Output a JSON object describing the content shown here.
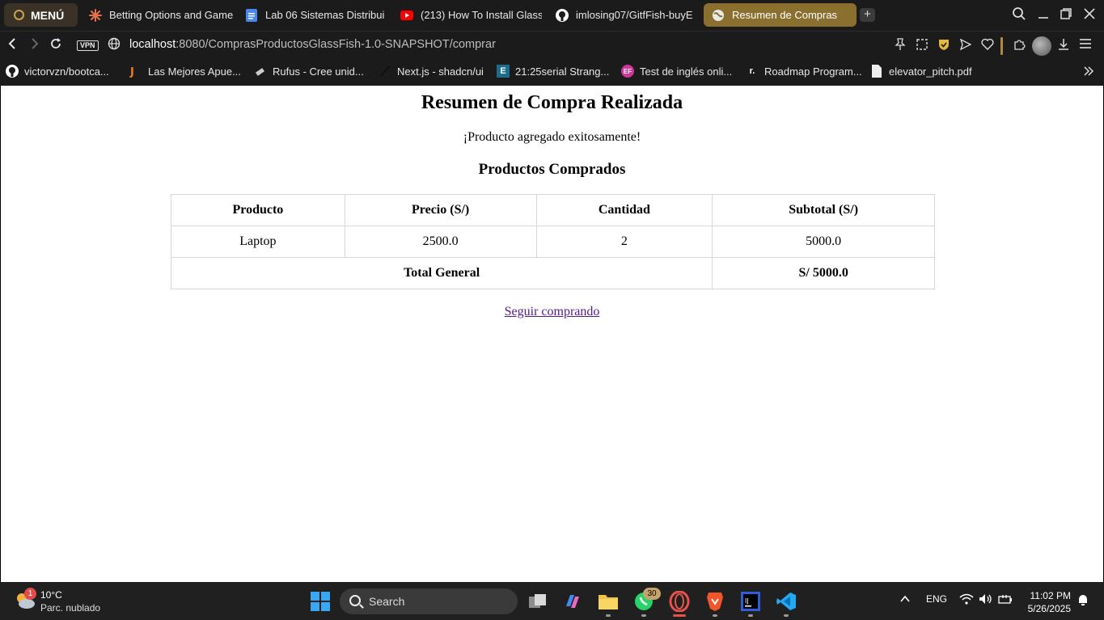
{
  "browser": {
    "menu_label": "MENÚ",
    "tabs": [
      {
        "label": "Betting Options and Game",
        "icon": "burst-icon"
      },
      {
        "label": "Lab 06 Sistemas Distribui",
        "icon": "docs-icon"
      },
      {
        "label": "(213) How To Install Glass",
        "icon": "youtube-icon"
      },
      {
        "label": "imlosing07/GitfFish-buyE",
        "icon": "github-icon"
      },
      {
        "label": "Resumen de Compras",
        "icon": "globe-icon",
        "active": true
      }
    ],
    "vpn_label": "VPN",
    "url_host": "localhost",
    "url_path": ":8080/ComprasProductosGlassFish-1.0-SNAPSHOT/comprar",
    "bookmarks": [
      {
        "label": "victorvzn/bootca...",
        "icon": "github-icon"
      },
      {
        "label": "Las Mejores Apue...",
        "icon": "bet-icon"
      },
      {
        "label": "Rufus - Cree unid...",
        "icon": "usb-icon"
      },
      {
        "label": "Next.js - shadcn/ui",
        "icon": "slash-icon"
      },
      {
        "label": "21:25serial Strang...",
        "icon": "e-icon"
      },
      {
        "label": "Test de inglés onli...",
        "icon": "ef-icon"
      },
      {
        "label": "Roadmap Program...",
        "icon": "roadmap-icon"
      },
      {
        "label": "elevator_pitch.pdf",
        "icon": "file-icon"
      }
    ],
    "accent": "#8a6f2f"
  },
  "page": {
    "title": "Resumen de Compra Realizada",
    "message": "¡Producto agregado exitosamente!",
    "section_title": "Productos Comprados",
    "table": {
      "headers": [
        "Producto",
        "Precio (S/)",
        "Cantidad",
        "Subtotal (S/)"
      ],
      "rows": [
        [
          "Laptop",
          "2500.0",
          "2",
          "5000.0"
        ]
      ],
      "total_label": "Total General",
      "total_value": "S/ 5000.0"
    },
    "link_label": "Seguir comprando"
  },
  "taskbar": {
    "weather_badge": "1",
    "temperature": "10°C",
    "condition": "Parc. nublado",
    "search_placeholder": "Search",
    "whatsapp_badge": "30",
    "language": "ENG",
    "time": "11:02 PM",
    "date": "5/26/2025"
  }
}
